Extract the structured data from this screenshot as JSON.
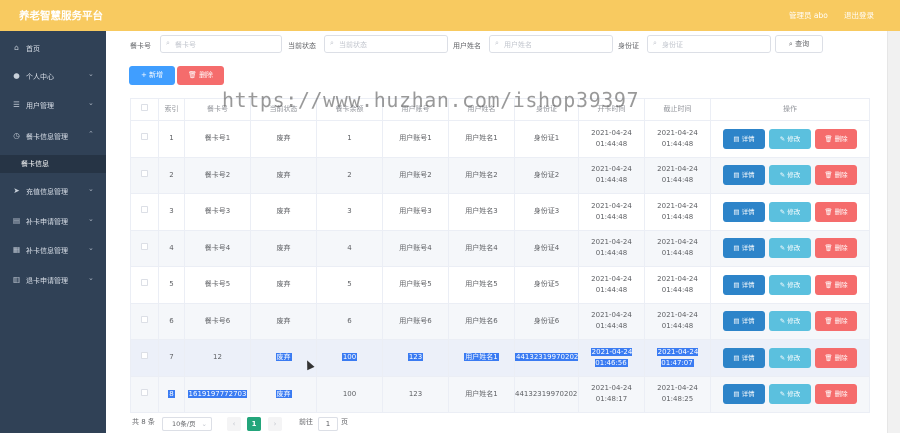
{
  "app": {
    "title": "养老智慧服务平台",
    "admin": "管理员 abo",
    "logout": "退出登录"
  },
  "sidebar": {
    "items": [
      {
        "label": "首页",
        "icon": "home-icon",
        "glyph": "⌂",
        "chevron": false
      },
      {
        "label": "个人中心",
        "icon": "user-icon",
        "glyph": "●",
        "chevron": true
      },
      {
        "label": "用户管理",
        "icon": "users-icon",
        "glyph": "☰",
        "chevron": true
      },
      {
        "label": "餐卡信息管理",
        "icon": "clock-icon",
        "glyph": "◷",
        "chevron": true,
        "expanded": true
      },
      {
        "label": "餐卡信息",
        "icon": "",
        "glyph": "",
        "chevron": false,
        "sub": true
      },
      {
        "label": "充值信息管理",
        "icon": "send-icon",
        "glyph": "➤",
        "chevron": true
      },
      {
        "label": "补卡申请管理",
        "icon": "doc-icon",
        "glyph": "▤",
        "chevron": true
      },
      {
        "label": "补卡信息管理",
        "icon": "shop-icon",
        "glyph": "▦",
        "chevron": true
      },
      {
        "label": "退卡申请管理",
        "icon": "file-icon",
        "glyph": "▥",
        "chevron": true
      }
    ]
  },
  "filters": {
    "card_no": {
      "label": "餐卡号",
      "placeholder": "餐卡号"
    },
    "status": {
      "label": "当前状态",
      "placeholder": "当前状态"
    },
    "username": {
      "label": "用户姓名",
      "placeholder": "用户姓名"
    },
    "idcard": {
      "label": "身份证",
      "placeholder": "身份证"
    },
    "query_label": "查询"
  },
  "toolbar": {
    "add_label": "+ 新增",
    "batch_delete_label": "删除"
  },
  "table": {
    "headers": [
      "索引",
      "餐卡号",
      "当前状态",
      "餐卡余额",
      "用户账号",
      "用户姓名",
      "身份证",
      "开卡时间",
      "截止时间",
      "操作"
    ],
    "rows": [
      {
        "idx": "1",
        "card": "餐卡号1",
        "status": "废弃",
        "balance": "1",
        "account": "用户账号1",
        "name": "用户姓名1",
        "id": "身份证1",
        "open": "2021-04-24 01:44:48",
        "end": "2021-04-24 01:44:48"
      },
      {
        "idx": "2",
        "card": "餐卡号2",
        "status": "废弃",
        "balance": "2",
        "account": "用户账号2",
        "name": "用户姓名2",
        "id": "身份证2",
        "open": "2021-04-24 01:44:48",
        "end": "2021-04-24 01:44:48"
      },
      {
        "idx": "3",
        "card": "餐卡号3",
        "status": "废弃",
        "balance": "3",
        "account": "用户账号3",
        "name": "用户姓名3",
        "id": "身份证3",
        "open": "2021-04-24 01:44:48",
        "end": "2021-04-24 01:44:48"
      },
      {
        "idx": "4",
        "card": "餐卡号4",
        "status": "废弃",
        "balance": "4",
        "account": "用户账号4",
        "name": "用户姓名4",
        "id": "身份证4",
        "open": "2021-04-24 01:44:48",
        "end": "2021-04-24 01:44:48"
      },
      {
        "idx": "5",
        "card": "餐卡号5",
        "status": "废弃",
        "balance": "5",
        "account": "用户账号5",
        "name": "用户姓名5",
        "id": "身份证5",
        "open": "2021-04-24 01:44:48",
        "end": "2021-04-24 01:44:48"
      },
      {
        "idx": "6",
        "card": "餐卡号6",
        "status": "废弃",
        "balance": "6",
        "account": "用户账号6",
        "name": "用户姓名6",
        "id": "身份证6",
        "open": "2021-04-24 01:44:48",
        "end": "2021-04-24 01:44:48"
      },
      {
        "idx": "7",
        "card": "12",
        "status": "废弃",
        "balance": "100",
        "account": "123",
        "name": "用户姓名1",
        "id": "441323199702021452",
        "open": "2021-04-24 01:46:56",
        "end": "2021-04-24 01:47:07"
      },
      {
        "idx": "8",
        "card": "1619197772703",
        "status": "废弃",
        "balance": "100",
        "account": "123",
        "name": "用户姓名1",
        "id": "441323199702021452",
        "open": "2021-04-24 01:48:17",
        "end": "2021-04-24 01:48:25"
      }
    ],
    "actions": {
      "detail": "详情",
      "edit": "修改",
      "delete": "删除"
    }
  },
  "pagination": {
    "total": "共 8 条",
    "page_size": "10条/页",
    "current_page": "1",
    "goto_prefix": "前往",
    "goto_value": "1",
    "goto_suffix": "页"
  },
  "watermark": "https://www.huzhan.com/ishop39397",
  "colors": {
    "header": "#f8ca60",
    "sidebar": "#304156",
    "primary": "#409eff",
    "danger": "#f56c6c",
    "info": "#5bc0de",
    "detail": "#2d84c9",
    "selection": "#3a7bf2"
  }
}
